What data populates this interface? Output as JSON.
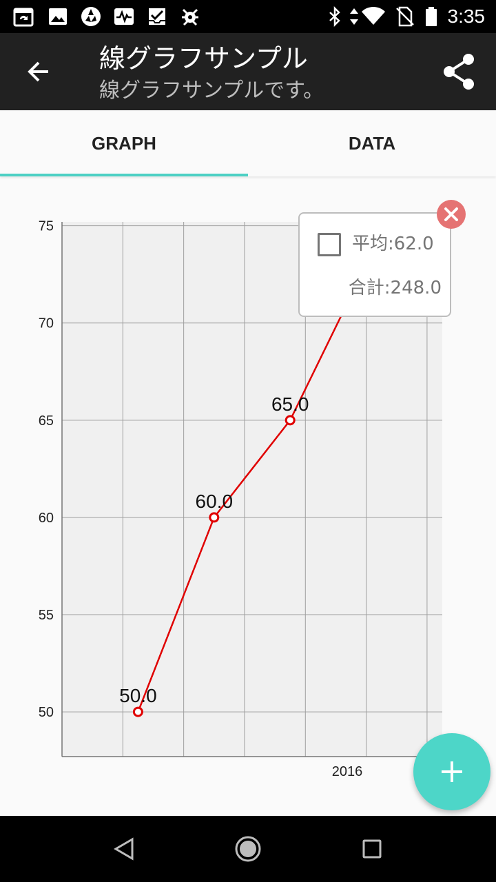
{
  "status_bar": {
    "time": "3:35",
    "left_icons": [
      "calendar-sync-icon",
      "image-icon",
      "aperture-icon",
      "pulse-icon",
      "inbox-check-icon",
      "bug-icon"
    ],
    "right_icons": [
      "bluetooth-icon",
      "data-arrows-icon",
      "wifi-icon",
      "no-sim-icon",
      "battery-icon"
    ]
  },
  "app_bar": {
    "title": "線グラフサンプル",
    "subtitle": "線グラフサンプルです。",
    "back_icon": "arrow-left-icon",
    "share_icon": "share-icon"
  },
  "tabs": [
    {
      "label": "GRAPH",
      "selected": true
    },
    {
      "label": "DATA",
      "selected": false
    }
  ],
  "colors": {
    "accent": "#4dd0c4",
    "fab": "#4dd6c8",
    "line": "#e00000",
    "close_button": "#e57373",
    "plot_background": "#f0f0f0"
  },
  "popup": {
    "average_label": "平均:62.0",
    "average_checked": false,
    "sum_label": "合計:248.0"
  },
  "chart_data": {
    "type": "line",
    "x": [
      1,
      2,
      3,
      4
    ],
    "values": [
      50.0,
      60.0,
      65.0,
      73.0
    ],
    "data_labels": [
      "50.0",
      "60.0",
      "65.0",
      ""
    ],
    "x_tick_labels": [
      {
        "x": 3.75,
        "label": "2016"
      }
    ],
    "y_ticks": [
      "50",
      "55",
      "60",
      "65",
      "70",
      "75"
    ],
    "ylim": [
      47.7,
      75.2
    ],
    "xlim": [
      0,
      5
    ],
    "grid": true
  },
  "fab": {
    "icon": "plus-icon"
  },
  "nav_bar": {
    "icons": [
      "triangle-back-icon",
      "circle-home-icon",
      "square-recents-icon"
    ]
  }
}
